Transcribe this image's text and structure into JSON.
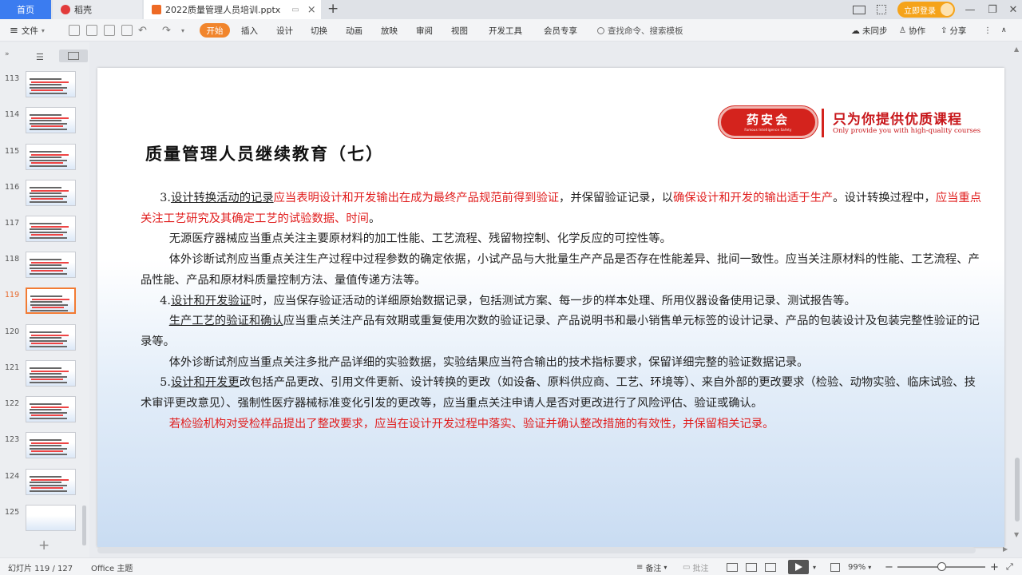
{
  "tabs": {
    "home": "首页",
    "daoke": "稻壳",
    "doc": "2022质量管理人员培训.pptx",
    "add": "+"
  },
  "titlebar": {
    "login": "立即登录",
    "minimize": "—",
    "restore": "❐",
    "close": "✕"
  },
  "menu": {
    "file": "文件",
    "items": [
      "开始",
      "插入",
      "设计",
      "切换",
      "动画",
      "放映",
      "审阅",
      "视图",
      "开发工具",
      "会员专享"
    ],
    "search": "查找命令、搜索模板",
    "sync": "未同步",
    "collab": "协作",
    "share": "分享"
  },
  "thumbnails": [
    {
      "num": "113"
    },
    {
      "num": "114"
    },
    {
      "num": "115"
    },
    {
      "num": "116"
    },
    {
      "num": "117"
    },
    {
      "num": "118"
    },
    {
      "num": "119"
    },
    {
      "num": "120"
    },
    {
      "num": "121"
    },
    {
      "num": "122"
    },
    {
      "num": "123"
    },
    {
      "num": "124"
    },
    {
      "num": "125"
    }
  ],
  "slide": {
    "logo_main": "药安会",
    "logo_sub": "Famous Intelligence Safety",
    "slogan": "只为你提供优质课程",
    "slogan_en": "Only provide you with high-quality courses",
    "title": "质量管理人员继续教育（七）",
    "p1_a": "3.",
    "p1_b": "设计转换活动的记录",
    "p1_c": "应当表明设计和开发输出在成为最终产品规范前得到验证",
    "p1_d": "，并保留验证记录，以",
    "p1_e": "确保设计和开发的输出适于生产",
    "p1_f": "。设计转换过程中，",
    "p1_g": "应当重点关注工艺研究及其确定工艺的试验数据、时间",
    "p1_h": "。",
    "p2": "无源医疗器械应当重点关注主要原材料的加工性能、工艺流程、残留物控制、化学反应的可控性等。",
    "p3": "体外诊断试剂应当重点关注生产过程中过程参数的确定依据，小试产品与大批量生产产品是否存在性能差异、批间一致性。应当关注原材料的性能、工艺流程、产品性能、产品和原材料质量控制方法、量值传递方法等。",
    "p4_a": "4.",
    "p4_b": "设计和开发验证",
    "p4_c": "时，应当保存验证活动的详细原始数据记录，包括测试方案、每一步的样本处理、所用仪器设备使用记录、测试报告等。",
    "p5_b": "生产工艺的验证和确认",
    "p5_c": "应当重点关注产品有效期或重复使用次数的验证记录、产品说明书和最小销售单元标签的设计记录、产品的包装设计及包装完整性验证的记录等。",
    "p6": "体外诊断试剂应当重点关注多批产品详细的实验数据，实验结果应当符合输出的技术指标要求，保留详细完整的验证数据记录。",
    "p7_a": "5.",
    "p7_b": "设计和开发更",
    "p7_c": "改包括产品更改、引用文件更新、设计转换的更改（如设备、原料供应商、工艺、环境等）、来自外部的更改要求（检验、动物实验、临床试验、技术审评更改意见）、强制性医疗器械标准变化引发的更改等，应当重点关注申请人是否对更改进行了风险评估、验证或确认。",
    "p8": "若检验机构对受检样品提出了整改要求，应当在设计开发过程中落实、验证并确认整改措施的有效性，并保留相关记录。"
  },
  "status": {
    "slide_counter": "幻灯片 119 / 127",
    "theme": "Office 主题",
    "notes": "备注",
    "comments": "批注",
    "zoom": "99%",
    "zoom_level": 0.5
  },
  "colors": {
    "accent": "#f1852c",
    "brand_red": "#d4231d",
    "body_red": "#e01d1d",
    "home_tab": "#3b7cf0"
  }
}
